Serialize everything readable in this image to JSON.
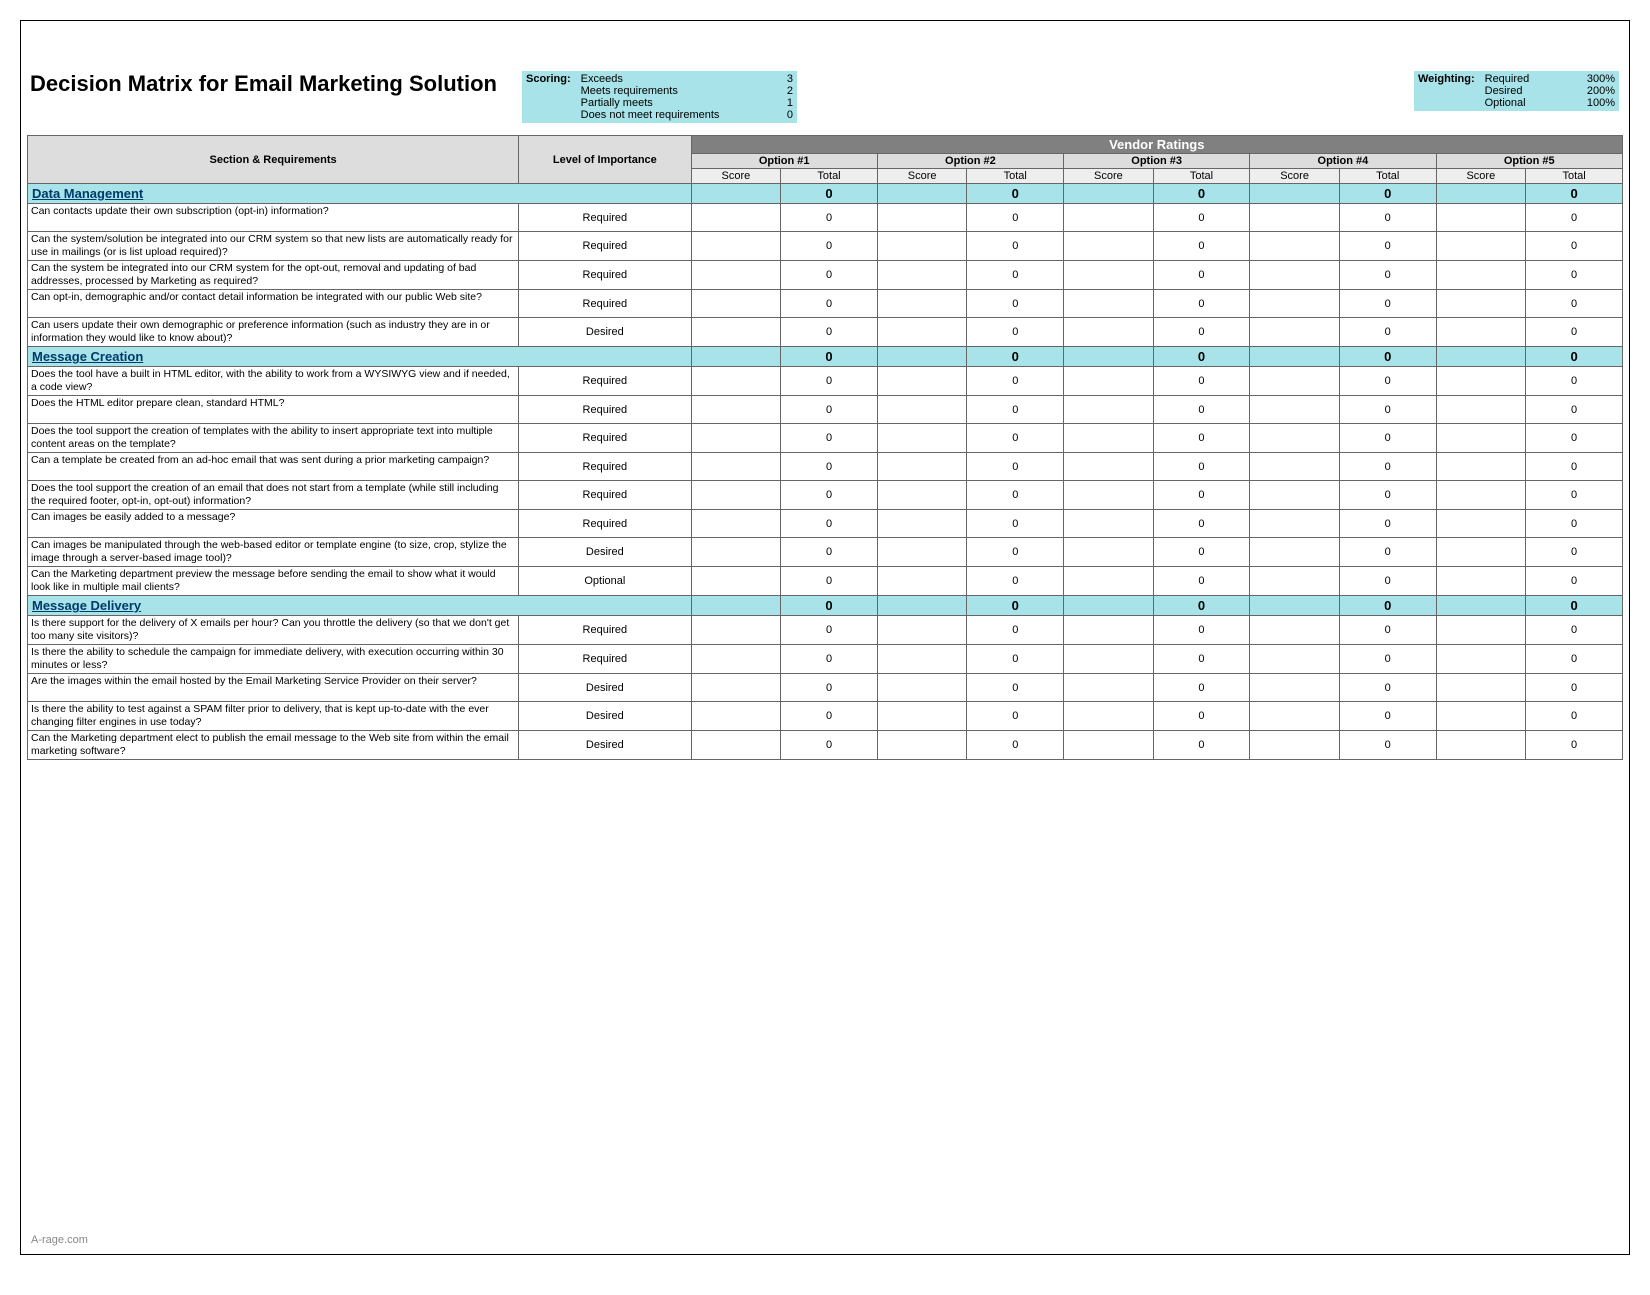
{
  "title": "Decision Matrix for Email Marketing Solution",
  "scoring": {
    "label": "Scoring:",
    "rows": [
      {
        "name": "Exceeds",
        "value": "3"
      },
      {
        "name": "Meets requirements",
        "value": "2"
      },
      {
        "name": "Partially meets",
        "value": "1"
      },
      {
        "name": "Does not meet requirements",
        "value": "0"
      }
    ]
  },
  "weighting": {
    "label": "Weighting:",
    "rows": [
      {
        "name": "Required",
        "value": "300%"
      },
      {
        "name": "Desired",
        "value": "200%"
      },
      {
        "name": "Optional",
        "value": "100%"
      }
    ]
  },
  "headers": {
    "vendor_ratings": "Vendor Ratings",
    "section_req": "Section & Requirements",
    "level": "Level of Importance",
    "options": [
      "Option #1",
      "Option #2",
      "Option #3",
      "Option #4",
      "Option #5"
    ],
    "score": "Score",
    "total": "Total"
  },
  "sections": [
    {
      "name": "Data Management",
      "totals": [
        "0",
        "0",
        "0",
        "0",
        "0"
      ],
      "rows": [
        {
          "req": "Can contacts update their own subscription (opt-in) information?",
          "level": "Required",
          "totals": [
            "0",
            "0",
            "0",
            "0",
            "0"
          ]
        },
        {
          "req": "Can the system/solution be integrated into our CRM system so that new lists are automatically ready for use in mailings (or is list upload required)?",
          "level": "Required",
          "totals": [
            "0",
            "0",
            "0",
            "0",
            "0"
          ]
        },
        {
          "req": "Can the system be integrated into our CRM system for the opt-out, removal and updating of bad addresses, processed by Marketing as required?",
          "level": "Required",
          "totals": [
            "0",
            "0",
            "0",
            "0",
            "0"
          ]
        },
        {
          "req": "Can opt-in, demographic and/or contact detail information be integrated with our public Web site?",
          "level": "Required",
          "totals": [
            "0",
            "0",
            "0",
            "0",
            "0"
          ]
        },
        {
          "req": "Can users update their own demographic or preference information (such as industry they are in or information they would like to know about)?",
          "level": "Desired",
          "totals": [
            "0",
            "0",
            "0",
            "0",
            "0"
          ]
        }
      ]
    },
    {
      "name": "Message Creation",
      "totals": [
        "0",
        "0",
        "0",
        "0",
        "0"
      ],
      "rows": [
        {
          "req": "Does the tool have a built in HTML editor, with the ability to work from a WYSIWYG view and if needed, a code view?",
          "level": "Required",
          "totals": [
            "0",
            "0",
            "0",
            "0",
            "0"
          ]
        },
        {
          "req": "Does the HTML editor prepare clean, standard HTML?",
          "level": "Required",
          "totals": [
            "0",
            "0",
            "0",
            "0",
            "0"
          ]
        },
        {
          "req": "Does the tool support the creation of templates with the ability to insert appropriate text into multiple content areas on the template?",
          "level": "Required",
          "totals": [
            "0",
            "0",
            "0",
            "0",
            "0"
          ]
        },
        {
          "req": "Can a template be created from an ad-hoc email that was sent during a prior marketing campaign?",
          "level": "Required",
          "totals": [
            "0",
            "0",
            "0",
            "0",
            "0"
          ]
        },
        {
          "req": "Does the tool support the creation of an email that does not start from a template (while still including the required footer, opt-in, opt-out) information?",
          "level": "Required",
          "totals": [
            "0",
            "0",
            "0",
            "0",
            "0"
          ]
        },
        {
          "req": "Can images be easily added to a message?",
          "level": "Required",
          "totals": [
            "0",
            "0",
            "0",
            "0",
            "0"
          ]
        },
        {
          "req": "Can images be manipulated through the web-based editor or template engine (to size, crop, stylize the image through a server-based image tool)?",
          "level": "Desired",
          "totals": [
            "0",
            "0",
            "0",
            "0",
            "0"
          ]
        },
        {
          "req": "Can the Marketing department preview the message before sending the email to show what it would look like in multiple mail clients?",
          "level": "Optional",
          "totals": [
            "0",
            "0",
            "0",
            "0",
            "0"
          ]
        }
      ]
    },
    {
      "name": "Message Delivery",
      "totals": [
        "0",
        "0",
        "0",
        "0",
        "0"
      ],
      "rows": [
        {
          "req": "Is there support for the delivery of X emails per hour?  Can you throttle the delivery (so that we don't get too many site visitors)?",
          "level": "Required",
          "totals": [
            "0",
            "0",
            "0",
            "0",
            "0"
          ]
        },
        {
          "req": "Is there the ability to schedule the campaign for immediate delivery, with execution occurring within 30 minutes or less?",
          "level": "Required",
          "totals": [
            "0",
            "0",
            "0",
            "0",
            "0"
          ]
        },
        {
          "req": "Are the images within the email hosted by the Email Marketing Service Provider on their server?",
          "level": "Desired",
          "totals": [
            "0",
            "0",
            "0",
            "0",
            "0"
          ]
        },
        {
          "req": "Is there the ability to test against a SPAM filter prior to delivery, that is kept up-to-date with the ever changing filter engines in use today?",
          "level": "Desired",
          "totals": [
            "0",
            "0",
            "0",
            "0",
            "0"
          ]
        },
        {
          "req": "Can the Marketing department elect to publish the email message to the Web site from within the email marketing software?",
          "level": "Desired",
          "totals": [
            "0",
            "0",
            "0",
            "0",
            "0"
          ]
        }
      ]
    }
  ],
  "footer": "A-rage.com"
}
